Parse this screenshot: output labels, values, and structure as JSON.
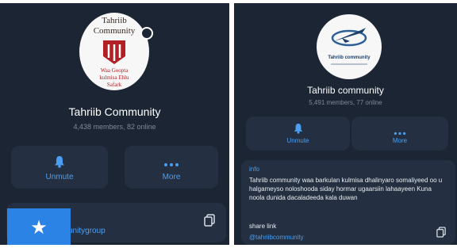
{
  "left": {
    "avatar": {
      "line1": "Tahriib",
      "line2": "Community",
      "tagline1": "Waa Goopta",
      "tagline2": "kulmisa Ehlu",
      "tagline3": "Safark"
    },
    "title": "Tahriib Community",
    "subtitle": "4,438 members, 82 online",
    "buttons": {
      "unmute": "Unmute",
      "more": "More"
    },
    "link_text": "unitygroup",
    "star_badge": "★"
  },
  "right": {
    "avatar": {
      "name": "Tahriib community"
    },
    "title": "Tahriib community",
    "subtitle": "5,491 members, 77 online",
    "buttons": {
      "unmute": "Unmute",
      "more": "More"
    },
    "info_label": "info",
    "info_text": "Tahriib community waa  barkulan kulmisa dhalinyaro somaliyeed  oo u halgameyso  noloshooda siday hormar ugaarsiin lahaayeen  Kuna noola dunida dacaladeeda kala duwan",
    "share_label": "share link",
    "share_link": "@tahriibcommunity"
  },
  "icons": {
    "bell": "bell-icon",
    "more": "more-dots-icon",
    "copy": "copy-icon",
    "star": "star-icon"
  },
  "colors": {
    "panel_bg": "#1b2533",
    "card_bg": "#243041",
    "accent": "#4a9ff5",
    "muted": "#7e8896",
    "badge": "#2c83e6"
  }
}
